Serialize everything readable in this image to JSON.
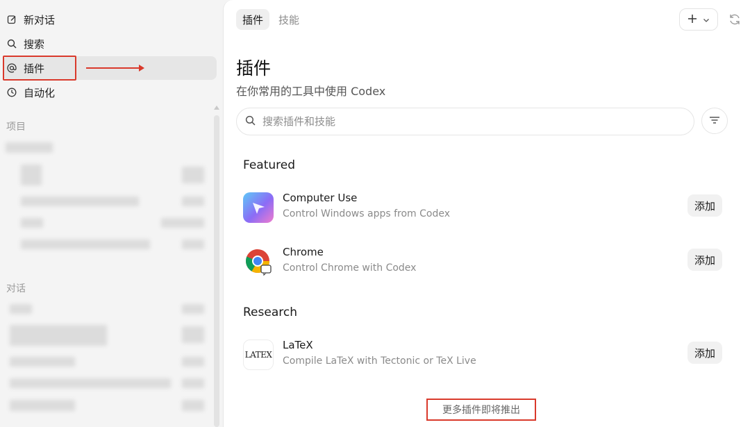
{
  "sidebar": {
    "nav": [
      {
        "label": "新对话",
        "icon": "edit-icon"
      },
      {
        "label": "搜索",
        "icon": "search-icon"
      },
      {
        "label": "插件",
        "icon": "at-sign-icon"
      },
      {
        "label": "自动化",
        "icon": "clock-icon"
      }
    ],
    "sections": {
      "projects": "项目",
      "conversations": "对话"
    }
  },
  "main": {
    "tabs": [
      {
        "label": "插件",
        "active": true
      },
      {
        "label": "技能",
        "active": false
      }
    ],
    "title": "插件",
    "subtitle": "在你常用的工具中使用 Codex",
    "search": {
      "placeholder": "搜索插件和技能"
    },
    "groups": [
      {
        "heading": "Featured",
        "items": [
          {
            "name": "Computer Use",
            "description": "Control Windows apps from Codex",
            "action": "添加",
            "icon": "computer-use-icon"
          },
          {
            "name": "Chrome",
            "description": "Control Chrome with Codex",
            "action": "添加",
            "icon": "chrome-icon"
          }
        ]
      },
      {
        "heading": "Research",
        "items": [
          {
            "name": "LaTeX",
            "description": "Compile LaTeX with Tectonic or TeX Live",
            "action": "添加",
            "icon": "latex-icon",
            "logo_text": "LATEX"
          }
        ]
      }
    ],
    "more_text": "更多插件即将推出"
  },
  "colors": {
    "annotation": "#d9392b",
    "sidebar_bg": "#f4f4f4",
    "panel_bg": "#ffffff"
  }
}
